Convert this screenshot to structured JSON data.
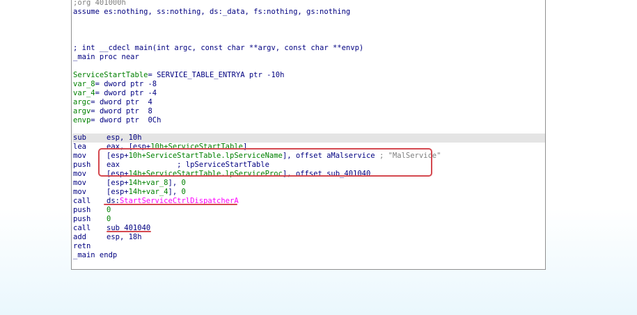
{
  "lines": {
    "org": ";org 401000h",
    "assume": "assume es:nothing, ss:nothing, ds:_data, fs:nothing, gs:nothing",
    "signature": "; int __cdecl main(int argc, const char **argv, const char **envp)",
    "proc": "_main proc near",
    "v1_name": "ServiceStartTable",
    "v1_def": "= SERVICE_TABLE_ENTRYA ptr -10h",
    "v2_name": "var_8",
    "v2_def": "= dword ptr -8",
    "v3_name": "var_4",
    "v3_def": "= dword ptr -4",
    "v4_name": "argc",
    "v4_def": "= dword ptr  4",
    "v5_name": "argv",
    "v5_def": "= dword ptr  8",
    "v6_name": "envp",
    "v6_def": "= dword ptr  0Ch",
    "endp": "_main endp"
  },
  "instructions": [
    {
      "mnemonic": "sub",
      "a": "esp, 10h"
    },
    {
      "mnemonic": "lea",
      "a": "eax, [esp+",
      "b": "10h+ServiceStartTable",
      "c": "]"
    },
    {
      "mnemonic": "mov",
      "a": "[esp+",
      "b": "10h+ServiceStartTable.lpServiceName",
      "c": "], offset aMalservice ",
      "d": "; \"MalService\""
    },
    {
      "mnemonic": "push",
      "a": "eax",
      "b": "             ; lpServiceStartTable"
    },
    {
      "mnemonic": "mov",
      "a": "[esp+",
      "b": "14h+ServiceStartTable.lpServiceProc",
      "c": "], offset sub_401040"
    },
    {
      "mnemonic": "mov",
      "a": "[esp+",
      "b": "14h+var_8",
      "c": "], ",
      "d": "0"
    },
    {
      "mnemonic": "mov",
      "a": "[esp+",
      "b": "14h+var_4",
      "c": "], ",
      "d": "0"
    },
    {
      "mnemonic": "call",
      "a": "ds:",
      "b": "StartServiceCtrlDispatcherA"
    },
    {
      "mnemonic": "push",
      "a": "0"
    },
    {
      "mnemonic": "push",
      "a": "0"
    },
    {
      "mnemonic": "call",
      "a": "sub_401040"
    },
    {
      "mnemonic": "add",
      "a": "esp, 18h"
    },
    {
      "mnemonic": "retn"
    }
  ]
}
